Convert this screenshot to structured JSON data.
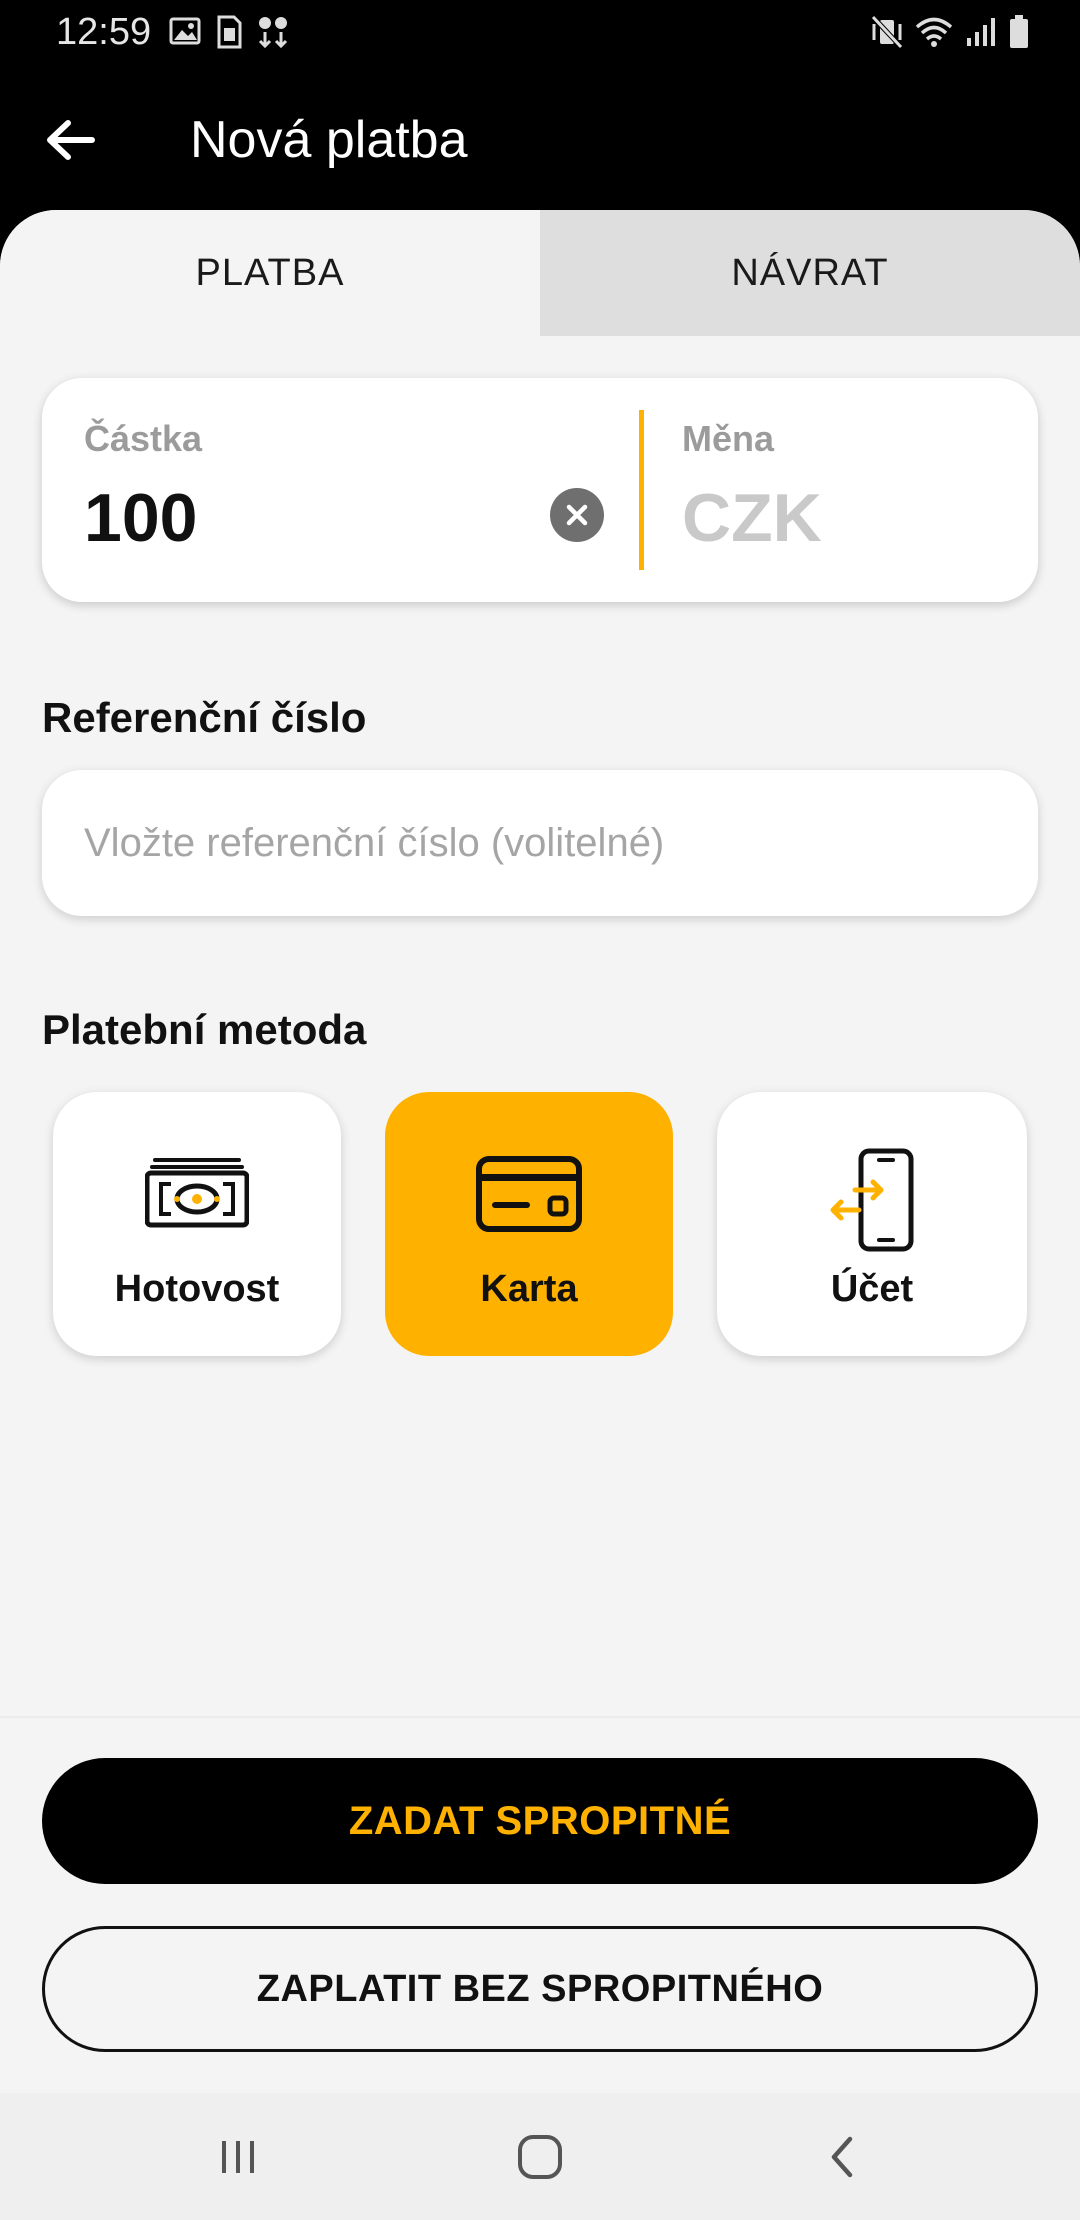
{
  "status_bar": {
    "time": "12:59",
    "left_icons": [
      "image-icon",
      "sim-card-icon",
      "download-icon"
    ],
    "right_icons": [
      "vibrate-off-icon",
      "wifi-icon",
      "signal-icon",
      "battery-icon"
    ]
  },
  "app_bar": {
    "title": "Nová platba",
    "back_icon": "arrow-left-icon"
  },
  "tabs": [
    {
      "label": "PLATBA",
      "active": true
    },
    {
      "label": "NÁVRAT",
      "active": false
    }
  ],
  "amount": {
    "label": "Částka",
    "value": "100",
    "clear_icon": "close-circle-icon",
    "currency_label": "Měna",
    "currency_value": "CZK"
  },
  "reference": {
    "label": "Referenční číslo",
    "placeholder": "Vložte referenční číslo (volitelné)",
    "value": ""
  },
  "payment_method": {
    "label": "Platební metoda",
    "options": [
      {
        "label": "Hotovost",
        "icon": "cash-icon",
        "selected": false
      },
      {
        "label": "Karta",
        "icon": "credit-card-icon",
        "selected": true
      },
      {
        "label": "Účet",
        "icon": "phone-transfer-icon",
        "selected": false
      }
    ]
  },
  "buttons": {
    "tip": "ZADAT SPROPITNÉ",
    "no_tip": "ZAPLATIT BEZ SPROPITNÉHO"
  },
  "colors": {
    "accent": "#ffb100",
    "dark": "#000000",
    "background": "#f4f4f4"
  }
}
